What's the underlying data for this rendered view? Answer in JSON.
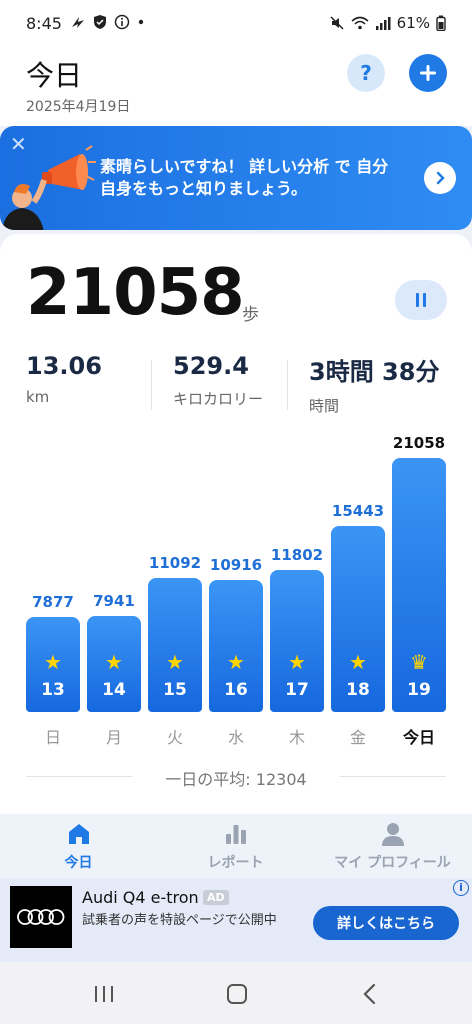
{
  "status_bar": {
    "time": "8:45",
    "battery": "61%",
    "icons": [
      "bolt-icon",
      "shield-icon",
      "info-icon",
      "dot-icon",
      "mute-icon",
      "wifi-icon",
      "signal-icon",
      "battery-icon"
    ]
  },
  "header": {
    "title": "今日",
    "date": "2025年4月19日",
    "help_label": "?"
  },
  "banner": {
    "text": "素晴らしいですね！ 詳しい分析 で 自分自身をもっと知りましょう。"
  },
  "summary": {
    "steps": "21058",
    "steps_unit": "歩",
    "stats": [
      {
        "value": "13.06",
        "label": "km"
      },
      {
        "value": "529.4",
        "label": "キロカロリー"
      },
      {
        "value": "3時間 38分",
        "label": "時間"
      }
    ]
  },
  "chart_data": {
    "type": "bar",
    "categories": [
      "日",
      "月",
      "火",
      "水",
      "木",
      "金",
      "今日"
    ],
    "days": [
      "13",
      "14",
      "15",
      "16",
      "17",
      "18",
      "19"
    ],
    "values": [
      7877,
      7941,
      11092,
      10916,
      11802,
      15443,
      21058
    ],
    "value_labels": [
      "7877",
      "7941",
      "11092",
      "10916",
      "11802",
      "15443",
      "21058"
    ],
    "markers": [
      "★",
      "★",
      "★",
      "★",
      "★",
      "★",
      "♛"
    ],
    "highlight": "今日",
    "ylim": [
      0,
      21058
    ]
  },
  "average": {
    "text": "一日の平均: 12304"
  },
  "bottom_nav": {
    "items": [
      {
        "label": "今日",
        "icon": "home-icon",
        "active": true
      },
      {
        "label": "レポート",
        "icon": "bar-chart-icon",
        "active": false
      },
      {
        "label": "マイ プロフィール",
        "icon": "profile-icon",
        "active": false
      }
    ]
  },
  "ad": {
    "title": "Audi Q4 e-tron",
    "badge": "AD",
    "description": "試乗者の声を特設ページで公開中",
    "cta": "詳しくはこちら",
    "info": "i"
  },
  "colors": {
    "accent": "#1f7ae6",
    "bar_top": "#3b95f5",
    "bar_bottom": "#1668de",
    "star": "#ffd400"
  }
}
